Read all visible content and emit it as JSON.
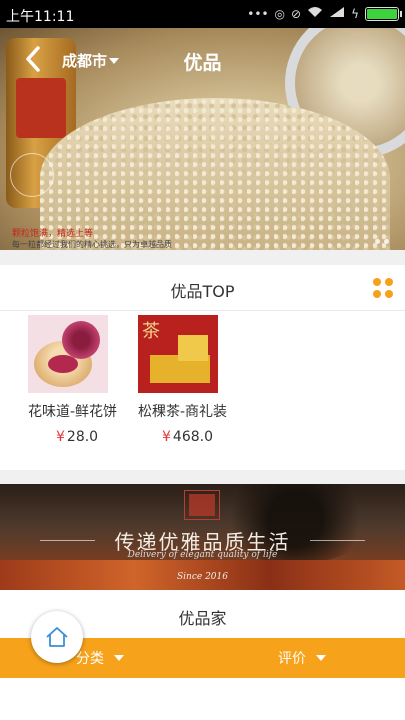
{
  "status_bar": {
    "time": "上午11:11",
    "battery_level": 1.0
  },
  "header": {
    "city": "成都市",
    "title": "优品"
  },
  "hero": {
    "caption_highlight": "颗粒饱满，精选上等",
    "caption_detail": "每一粒都经过我们的精心挑选，只为卓越品质"
  },
  "top_section": {
    "title": "优品TOP"
  },
  "products": [
    {
      "name": "花味道-鲜花饼",
      "currency": "¥",
      "price": "28.0"
    },
    {
      "name": "松稞茶-商礼装",
      "currency": "¥",
      "price": "468.0"
    }
  ],
  "tea_image": {
    "char": "茶"
  },
  "banner2": {
    "slogan": "传递优雅品质生活",
    "subtitle": "Delivery of elegant quality of life",
    "since": "Since 2016"
  },
  "home_section": {
    "title": "优品家"
  },
  "filters": {
    "category": "分类",
    "rating": "评价"
  },
  "colors": {
    "accent": "#f7a21b",
    "price": "#e4393c"
  }
}
